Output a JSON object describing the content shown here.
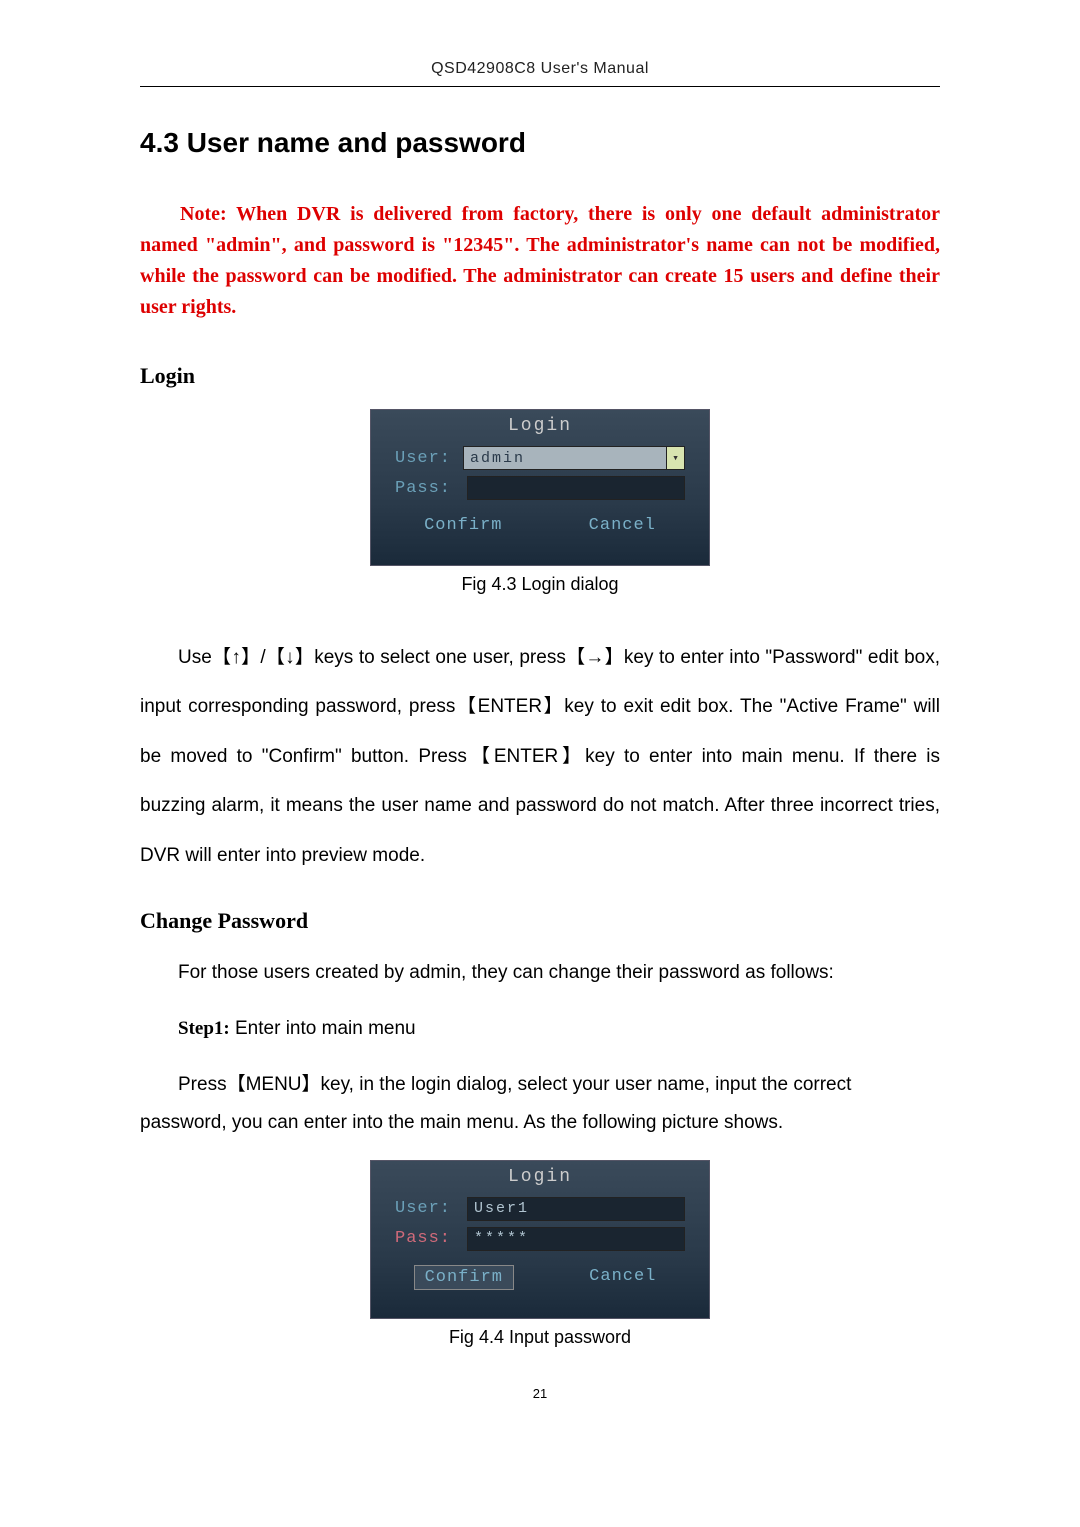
{
  "header": "QSD42908C8 User's Manual",
  "section_title": "4.3 User name and password",
  "note_text": "Note: When DVR is delivered from factory, there is only one default administrator named \"admin\", and password is \"12345\". The administrator's name can not be modified, while the password can be modified. The administrator can create 15 users and define their user rights.",
  "sub_login": "Login",
  "login_dialog_1": {
    "title": "Login",
    "user_label": "User:",
    "user_value": "admin",
    "pass_label": "Pass:",
    "pass_value": "",
    "confirm": "Confirm",
    "cancel": "Cancel"
  },
  "figcap_1": "Fig 4.3 Login dialog",
  "body_1": "Use【↑】/【↓】keys to select one user, press【→】key to enter into \"Password\" edit box, input corresponding password, press【ENTER】key to exit edit box. The \"Active Frame\" will be moved to \"Confirm\" button. Press【ENTER】key to enter into main menu. If there is buzzing alarm, it means the user name and password do not match. After three incorrect tries, DVR will enter into preview mode.",
  "sub_change": "Change Password",
  "body_2": "For those users created by admin, they can change their password as follows:",
  "step1_label": "Step1:",
  "step1_text": " Enter into main menu",
  "body_3": "Press【MENU】key, in the login dialog, select your user name, input the correct password, you can enter into the main menu. As the following picture shows.",
  "login_dialog_2": {
    "title": "Login",
    "user_label": "User:",
    "user_value": "User1",
    "pass_label": "Pass:",
    "pass_value": "*****",
    "confirm": "Confirm",
    "cancel": "Cancel"
  },
  "figcap_2": "Fig 4.4 Input password",
  "page_number": "21"
}
